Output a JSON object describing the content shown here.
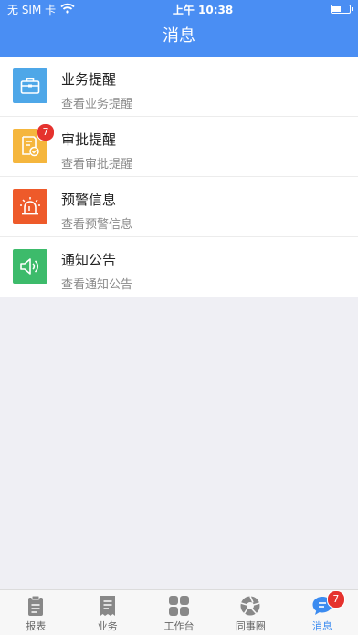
{
  "status_bar": {
    "carrier": "无 SIM 卡",
    "time": "上午 10:38",
    "battery_level": 0.5
  },
  "header": {
    "title": "消息"
  },
  "messages": [
    {
      "title": "业务提醒",
      "subtitle": "查看业务提醒",
      "icon": "briefcase-icon",
      "color": "#4ea7e8",
      "badge": ""
    },
    {
      "title": "审批提醒",
      "subtitle": "查看审批提醒",
      "icon": "approval-doc-icon",
      "color": "#f5b63d",
      "badge": "7"
    },
    {
      "title": "预警信息",
      "subtitle": "查看预警信息",
      "icon": "alarm-light-icon",
      "color": "#ee5a2a",
      "badge": ""
    },
    {
      "title": "通知公告",
      "subtitle": "查看通知公告",
      "icon": "speaker-icon",
      "color": "#3dbb6b",
      "badge": ""
    }
  ],
  "tabbar": {
    "active": "消息",
    "tabs": [
      {
        "label": "报表",
        "icon": "clipboard-icon",
        "badge": ""
      },
      {
        "label": "业务",
        "icon": "receipt-icon",
        "badge": ""
      },
      {
        "label": "工作台",
        "icon": "grid-icon",
        "badge": ""
      },
      {
        "label": "同事圈",
        "icon": "aperture-icon",
        "badge": ""
      },
      {
        "label": "消息",
        "icon": "chat-bubble-icon",
        "badge": "7"
      }
    ]
  },
  "colors": {
    "header_bg": "#4a8ef3",
    "badge": "#e5322e",
    "tab_active": "#3b8bf0"
  }
}
